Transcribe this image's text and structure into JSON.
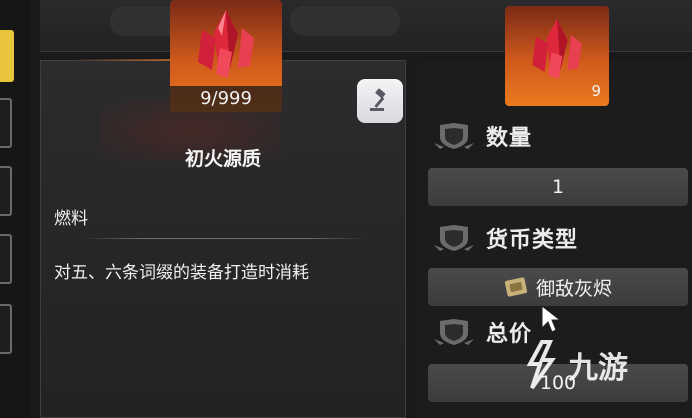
{
  "item": {
    "name": "初火源质",
    "count_label": "9/999",
    "type": "燃料",
    "description": "对五、六条词缀的装备打造时消耗",
    "stack_quantity": "9"
  },
  "trade_panel": {
    "quantity_label": "数量",
    "quantity_value": "1",
    "currency_label": "货币类型",
    "currency_value": "御敌灰烬",
    "total_label": "总价",
    "total_value": "100"
  },
  "watermark": {
    "text": "九游"
  },
  "icons": {
    "item": "red-crystal-icon",
    "auction": "gavel-icon",
    "section": "shield-icon",
    "currency": "ticket-icon",
    "cursor": "pointer-cursor-icon"
  },
  "colors": {
    "icon_bg_top": "#7a2a16",
    "icon_bg_bottom": "#e9761f",
    "accent_yellow": "#e8c53a",
    "accent_orange": "#e37a2e",
    "crystal_red": "#e0283c"
  }
}
